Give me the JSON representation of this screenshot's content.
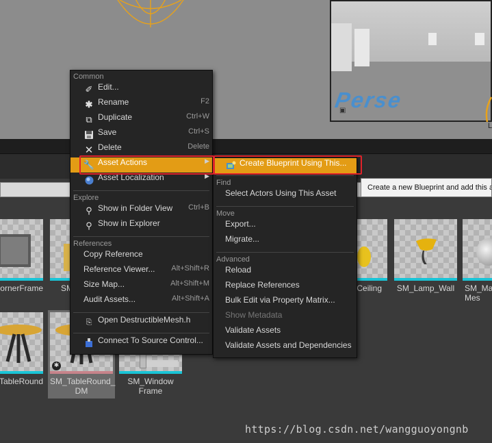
{
  "viewport": {
    "preview_text": "Perse",
    "corner_letter": "L"
  },
  "assets": {
    "row1": [
      {
        "label": "CornerFrame"
      },
      {
        "label": "SM_"
      },
      {
        "label": "p_Ceiling"
      },
      {
        "label": "SM_Lamp_Wall"
      },
      {
        "label": "SM_Ma\nMes"
      }
    ],
    "row2": [
      {
        "label": "TableRound"
      },
      {
        "label": "SM_TableRound_\nDM"
      },
      {
        "label": "SM_Window\nFrame"
      }
    ]
  },
  "context_menu": {
    "common_header": "Common",
    "items_common": [
      {
        "label": "Edit...",
        "shortcut": "",
        "icon": "pencil-icon"
      },
      {
        "label": "Rename",
        "shortcut": "F2",
        "icon": "rename-icon"
      },
      {
        "label": "Duplicate",
        "shortcut": "Ctrl+W",
        "icon": "duplicate-icon"
      },
      {
        "label": "Save",
        "shortcut": "Ctrl+S",
        "icon": "save-icon"
      },
      {
        "label": "Delete",
        "shortcut": "Delete",
        "icon": "delete-icon"
      },
      {
        "label": "Asset Actions",
        "shortcut": "",
        "icon": "wrench-icon"
      },
      {
        "label": "Asset Localization",
        "shortcut": "",
        "icon": "globe-icon"
      }
    ],
    "explore_header": "Explore",
    "items_explore": [
      {
        "label": "Show in Folder View",
        "shortcut": "Ctrl+B",
        "icon": "magnifier-icon"
      },
      {
        "label": "Show in Explorer",
        "shortcut": "",
        "icon": "magnifier-icon"
      }
    ],
    "references_header": "References",
    "items_references": [
      {
        "label": "Copy Reference",
        "shortcut": ""
      },
      {
        "label": "Reference Viewer...",
        "shortcut": "Alt+Shift+R"
      },
      {
        "label": "Size Map...",
        "shortcut": "Alt+Shift+M"
      },
      {
        "label": "Audit Assets...",
        "shortcut": "Alt+Shift+A"
      }
    ],
    "items_source": [
      {
        "label": "Open DestructibleMesh.h",
        "icon": "code-file-icon"
      },
      {
        "label": "Connect To Source Control...",
        "icon": "source-control-icon"
      }
    ]
  },
  "submenu": {
    "top_item": {
      "label": "Create Blueprint Using This...",
      "icon": "blueprint-icon"
    },
    "find_header": "Find",
    "items_find": [
      {
        "label": "Select Actors Using This Asset"
      }
    ],
    "move_header": "Move",
    "items_move": [
      {
        "label": "Export..."
      },
      {
        "label": "Migrate..."
      }
    ],
    "advanced_header": "Advanced",
    "items_advanced": [
      {
        "label": "Reload"
      },
      {
        "label": "Replace References"
      },
      {
        "label": "Bulk Edit via Property Matrix..."
      },
      {
        "label": "Show Metadata",
        "disabled": true
      },
      {
        "label": "Validate Assets"
      },
      {
        "label": "Validate Assets and Dependencies"
      }
    ]
  },
  "tooltip": {
    "text": "Create a new Blueprint and add this a"
  },
  "watermark": {
    "text": "https://blog.csdn.net/wangguoyongnb"
  },
  "colors": {
    "highlight": "#e39c15",
    "menu_bg": "#252525",
    "annotation_red": "#e0232a",
    "asset_underline": "#19c4d6"
  }
}
